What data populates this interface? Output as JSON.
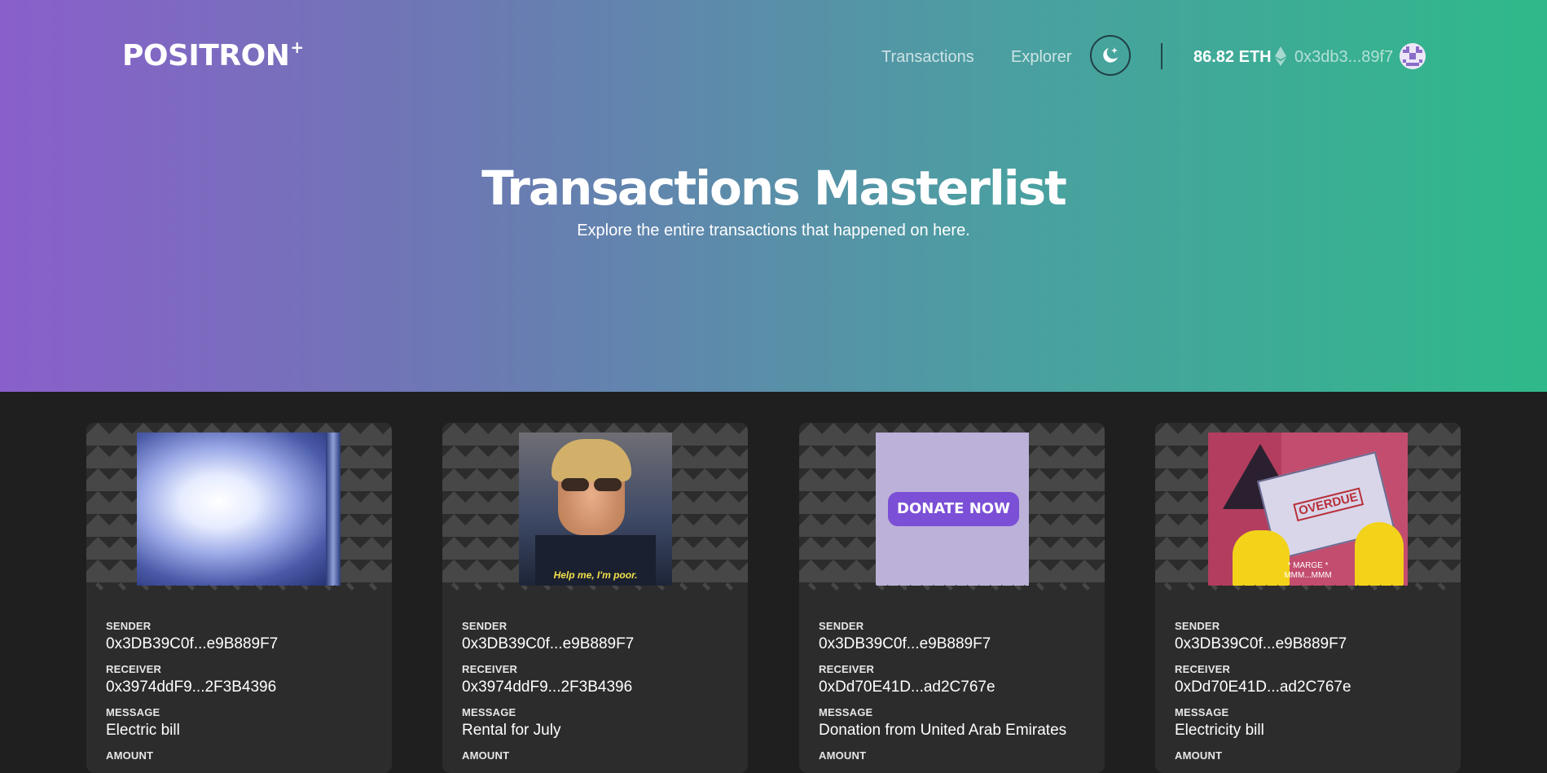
{
  "header": {
    "logo": "POSITRON",
    "logo_mark": "+",
    "nav": [
      {
        "label": "Transactions"
      },
      {
        "label": "Explorer"
      }
    ],
    "theme_toggle_icon": "moon-stars-icon",
    "balance": "86.82 ETH",
    "currency_icon": "ethereum-icon",
    "address": "0x3db3...89f7",
    "avatar_icon": "identicon-avatar"
  },
  "hero": {
    "title": "Transactions Masterlist",
    "subtitle": "Explore the entire transactions that happened on here."
  },
  "labels": {
    "sender": "SENDER",
    "receiver": "RECEIVER",
    "message": "MESSAGE",
    "amount": "AMOUNT"
  },
  "cards": [
    {
      "sender": "0x3DB39C0f...e9B889F7",
      "receiver": "0x3974ddF9...2F3B4396",
      "message": "Electric bill",
      "gif": "electric-flash-gif"
    },
    {
      "sender": "0x3DB39C0f...e9B889F7",
      "receiver": "0x3974ddF9...2F3B4396",
      "message": "Rental for July",
      "gif": "help-me-im-poor-gif",
      "gif_caption": "Help me, I'm poor."
    },
    {
      "sender": "0x3DB39C0f...e9B889F7",
      "receiver": "0xDd70E41D...ad2C767e",
      "message": "Donation from United Arab Emirates",
      "gif": "donate-now-gif",
      "gif_caption": "DONATE NOW"
    },
    {
      "sender": "0x3DB39C0f...e9B889F7",
      "receiver": "0xDd70E41D...ad2C767e",
      "message": "Electricity bill",
      "gif": "overdue-bill-gif",
      "gif_caption": "OVERDUE",
      "gif_caption_2": "* MARGE *",
      "gif_caption_3": "MMM...MMM"
    }
  ],
  "colors": {
    "gradient_start": "#8a5fcb",
    "gradient_end": "#2fb98a",
    "page_bg": "#1f1f1f",
    "card_bg": "#2c2c2c",
    "donate_button": "#7b4fd6"
  }
}
